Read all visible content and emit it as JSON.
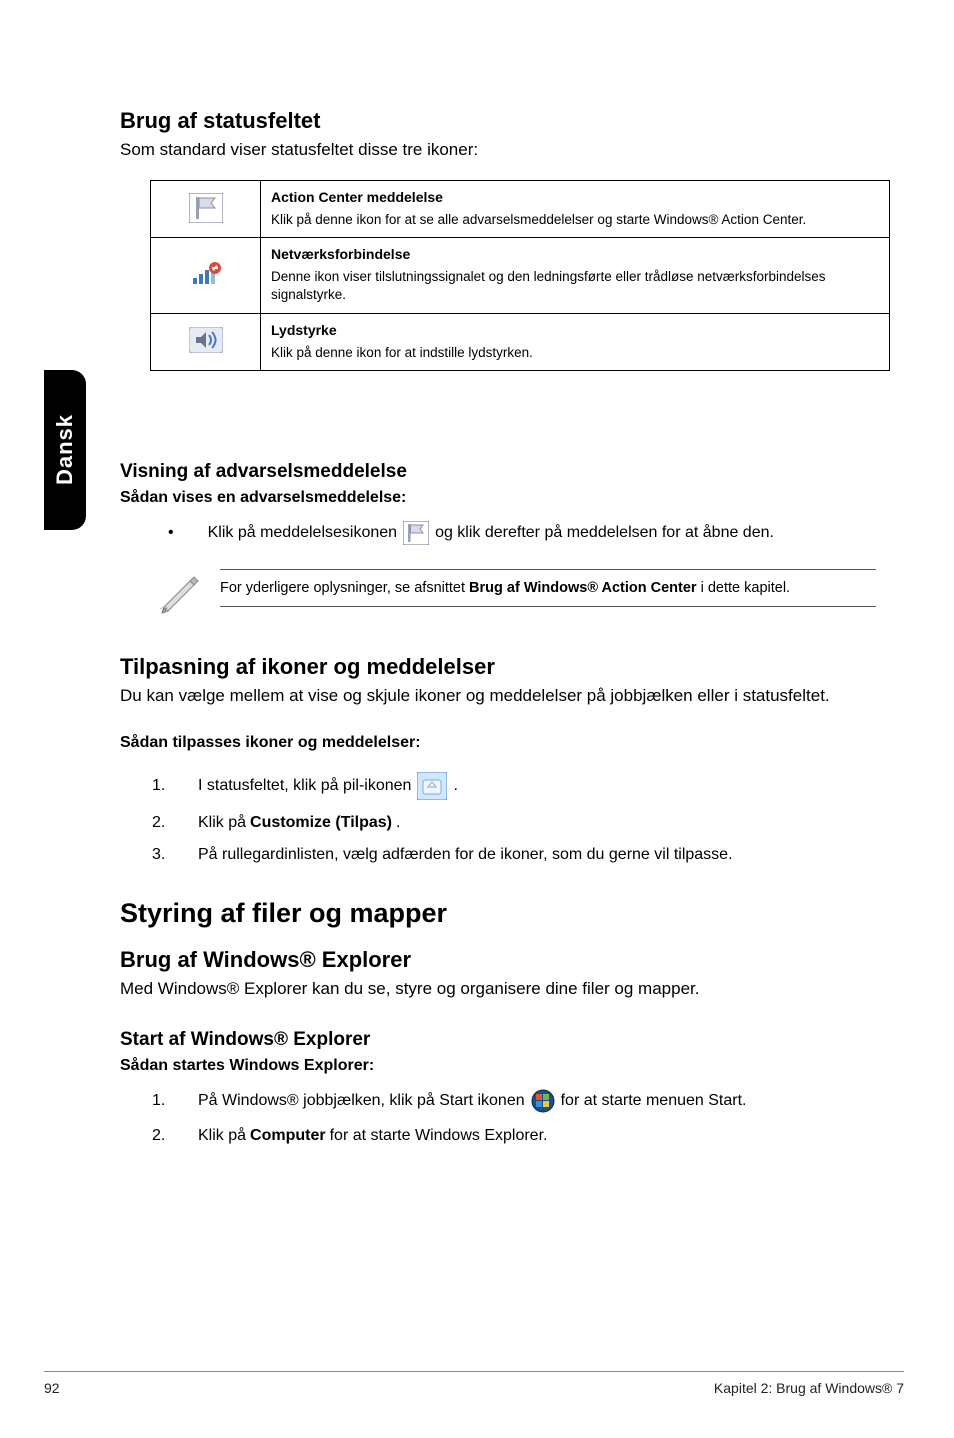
{
  "sideTab": "Dansk",
  "s1": {
    "title": "Brug af statusfeltet",
    "lead": "Som standard viser statusfeltet disse tre ikoner:",
    "rows": [
      {
        "title": "Action Center meddelelse",
        "desc": "Klik på denne ikon for at se alle advarselsmeddelelser og starte Windows® Action Center."
      },
      {
        "title": "Netværksforbindelse",
        "desc": "Denne ikon viser tilslutningssignalet og den ledningsførte eller trådløse netværksforbindelses signalstyrke."
      },
      {
        "title": "Lydstyrke",
        "desc": "Klik på denne ikon for at indstille lydstyrken."
      }
    ]
  },
  "s2": {
    "title": "Visning af advarselsmeddelelse",
    "subtitle": "Sådan vises en advarselsmeddelelse:",
    "bullet_pre": "Klik på meddelelsesikonen",
    "bullet_post": "og klik derefter på meddelelsen for at åbne den.",
    "note_pre": "For yderligere oplysninger, se afsnittet ",
    "note_bold": "Brug af Windows® Action Center",
    "note_post": " i dette kapitel."
  },
  "s3": {
    "title": "Tilpasning af ikoner og meddelelser",
    "lead": "Du kan vælge mellem at vise og skjule ikoner og meddelelser på jobbjælken eller i statusfeltet.",
    "subtitle": "Sådan tilpasses ikoner og meddelelser:",
    "steps": [
      {
        "pre": "I statusfeltet, klik på pil-ikonen",
        "post": "."
      },
      {
        "text_pre": "Klik på ",
        "text_bold": "Customize (Tilpas)",
        "text_post": "."
      },
      {
        "text": "På rullegardinlisten, vælg adfærden for de ikoner, som du gerne vil tilpasse."
      }
    ]
  },
  "s4": {
    "big": "Styring af filer og mapper",
    "h2": "Brug af Windows® Explorer",
    "lead": "Med Windows® Explorer kan du se, styre og organisere dine filer og mapper.",
    "h3": "Start af Windows® Explorer",
    "subtitle": "Sådan startes Windows Explorer:",
    "steps": [
      {
        "pre": "På Windows® jobbjælken, klik på Start ikonen",
        "post": "for at starte menuen Start."
      },
      {
        "text_pre": "Klik på ",
        "text_bold": "Computer",
        "text_post": " for at starte Windows Explorer."
      }
    ]
  },
  "footer": {
    "page": "92",
    "chapter": "Kapitel 2: Brug af Windows® 7"
  }
}
